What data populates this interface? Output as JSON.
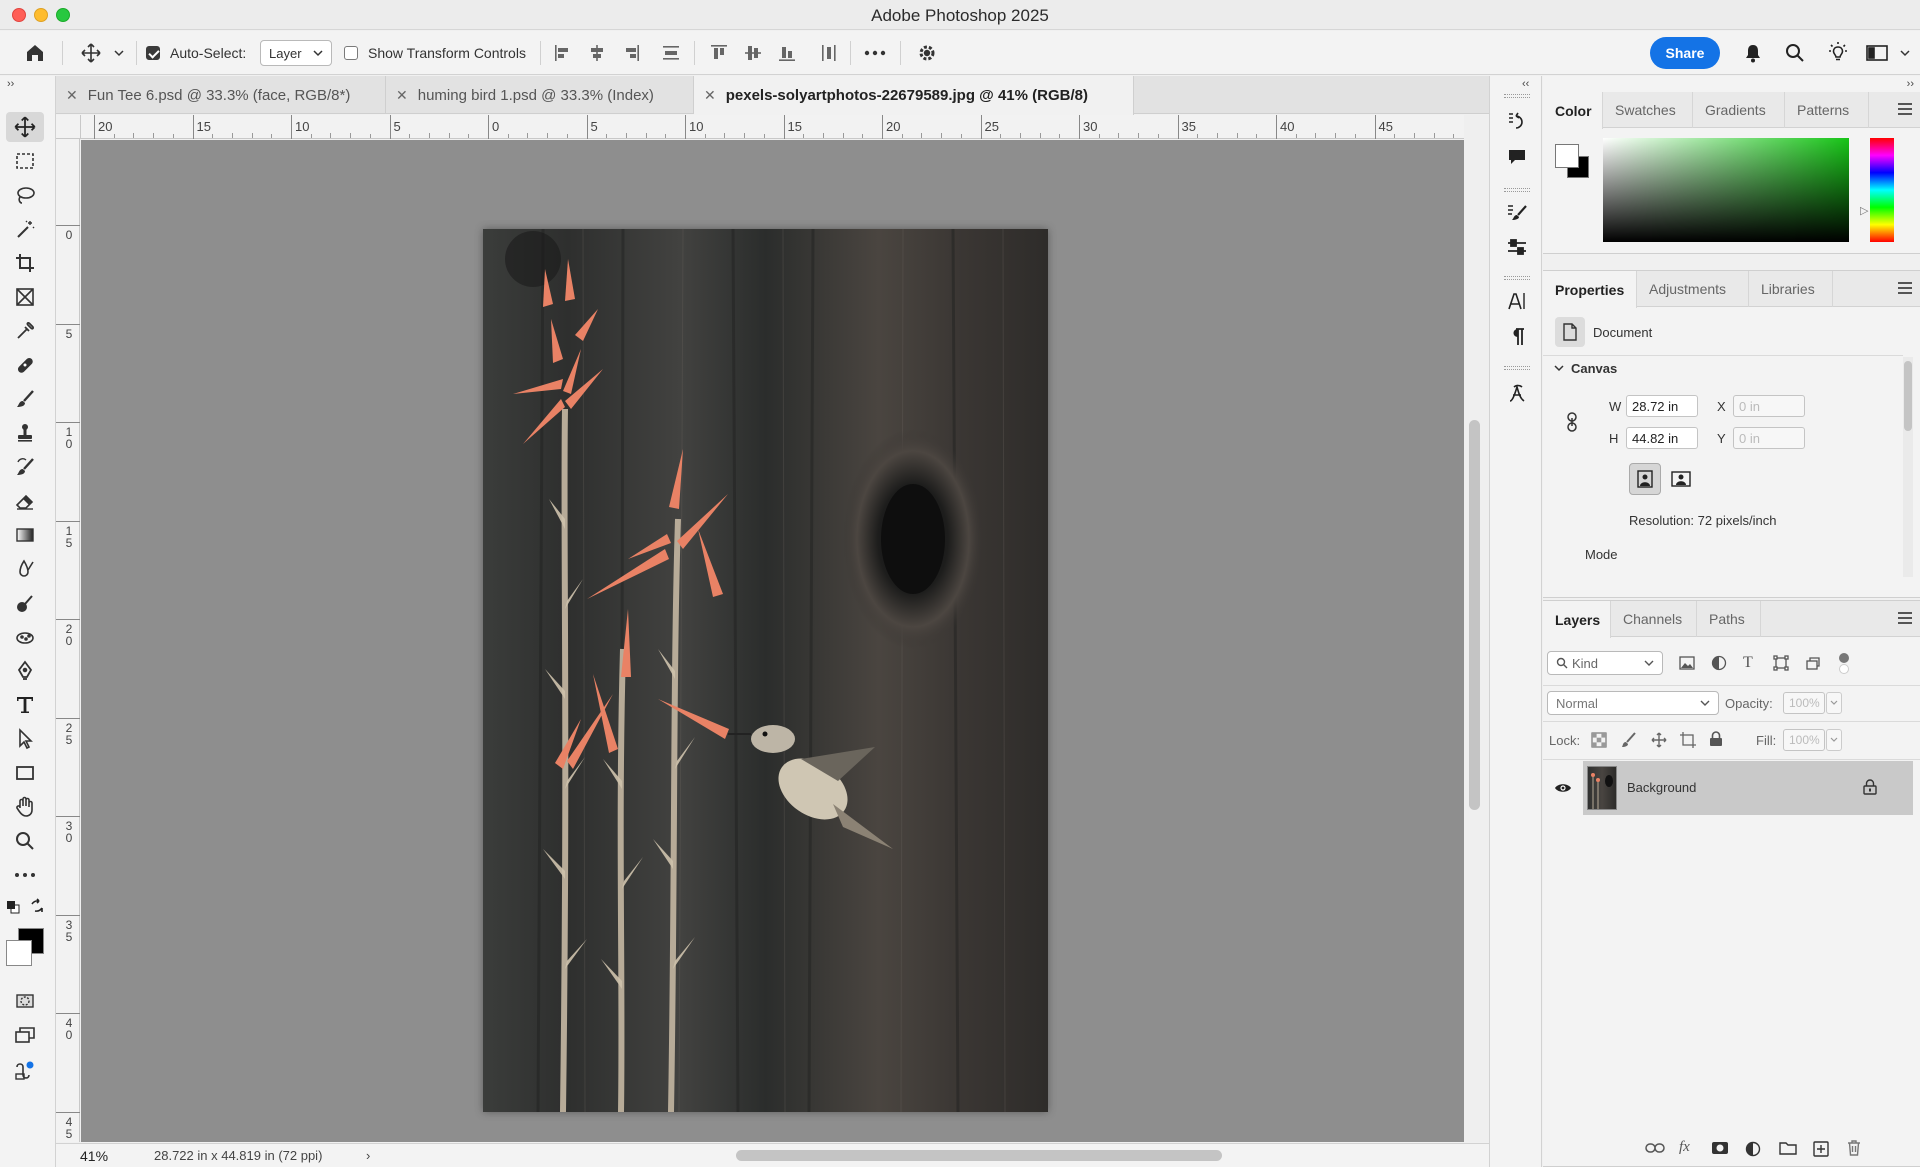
{
  "app": {
    "title": "Adobe Photoshop 2025"
  },
  "options": {
    "auto_select_label": "Auto-Select:",
    "auto_select_value": "Layer",
    "transform_label": "Show Transform Controls",
    "share": "Share"
  },
  "tabs": [
    {
      "label": "Fun Tee 6.psd @ 33.3% (face, RGB/8*)"
    },
    {
      "label": "huming bird 1.psd @ 33.3% (Index)"
    },
    {
      "label": "pexels-solyartphotos-22679589.jpg @ 41% (RGB/8)"
    }
  ],
  "ruler_h": [
    "20",
    "15",
    "10",
    "5",
    "0",
    "5",
    "10",
    "15",
    "20",
    "25",
    "30",
    "35",
    "40",
    "45"
  ],
  "ruler_v": [
    "0",
    "5",
    "10",
    "15",
    "20",
    "25",
    "30",
    "35",
    "40",
    "45"
  ],
  "status": {
    "zoom": "41%",
    "doc_info": "28.722 in x 44.819 in (72 ppi)"
  },
  "color_panel": {
    "tabs": [
      "Color",
      "Swatches",
      "Gradients",
      "Patterns"
    ],
    "hue_color": "#17c417"
  },
  "properties": {
    "tabs": [
      "Properties",
      "Adjustments",
      "Libraries"
    ],
    "doc_label": "Document",
    "canvas_label": "Canvas",
    "w_label": "W",
    "w_value": "28.72 in",
    "h_label": "H",
    "h_value": "44.82 in",
    "x_label": "X",
    "x_value": "0 in",
    "y_label": "Y",
    "y_value": "0 in",
    "resolution": "Resolution: 72 pixels/inch",
    "mode_label": "Mode"
  },
  "layers": {
    "tabs": [
      "Layers",
      "Channels",
      "Paths"
    ],
    "kind": "Kind",
    "blend_mode": "Normal",
    "opacity_label": "Opacity:",
    "opacity_value": "100%",
    "lock_label": "Lock:",
    "fill_label": "Fill:",
    "fill_value": "100%",
    "items": [
      {
        "name": "Background"
      }
    ]
  }
}
